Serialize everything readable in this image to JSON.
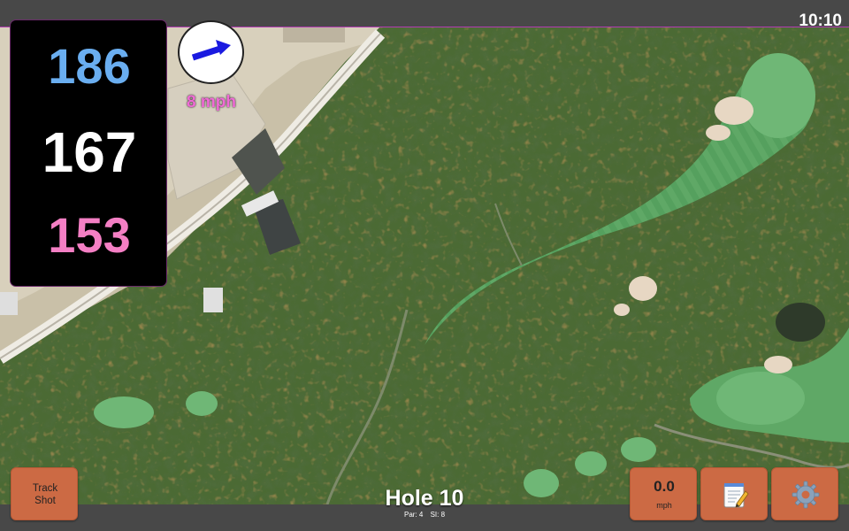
{
  "status_bar": {
    "time": "10:10"
  },
  "distances": {
    "back": "186",
    "middle": "167",
    "front": "153"
  },
  "wind": {
    "speed_label": "8 mph",
    "direction": "east-northeast",
    "arrow_icon": "wind-arrow-icon"
  },
  "hole": {
    "title": "Hole 10",
    "par_label": "Par: 4",
    "si_label": "SI: 8"
  },
  "buttons": {
    "track_shot_line1": "Track",
    "track_shot_line2": "Shot",
    "wind_value": "0.0",
    "wind_unit": "mph",
    "notes_icon": "notepad-icon",
    "settings_icon": "gear-icon"
  },
  "colors": {
    "back_distance": "#6aaef0",
    "middle_distance": "#ffffff",
    "front_distance": "#f47fc4",
    "wind_label": "#f06ad6",
    "button_bg": "#cc6a44",
    "wind_arrow": "#1a1ae0"
  }
}
